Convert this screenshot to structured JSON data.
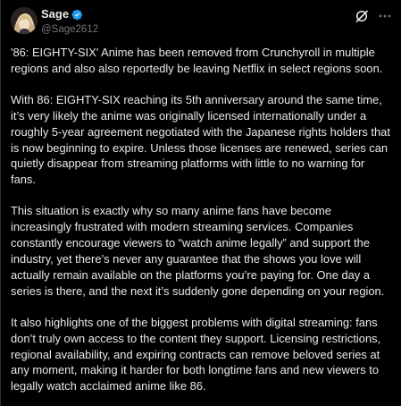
{
  "author": {
    "display_name": "Sage",
    "handle": "@Sage2612",
    "verified": true
  },
  "icons": {
    "avatar": "avatar-image",
    "verified": "verified-badge-icon",
    "grok": "grok-icon",
    "more": "more-options-icon"
  },
  "colors": {
    "background": "#000000",
    "text": "#e7e9ea",
    "muted": "#71767b",
    "verified": "#1d9bf0"
  },
  "post": {
    "paragraphs": [
      "'86: EIGHTY-SIX' Anime has been removed from Crunchyroll in multiple regions and also also reportedly be leaving Netflix in select regions soon.",
      "With 86: EIGHTY-SIX reaching its 5th anniversary around the same time, it’s very likely the anime was originally licensed internationally under a roughly 5-year agreement negotiated with the Japanese rights holders that is now beginning to expire. Unless those licenses are renewed, series can quietly disappear from streaming platforms with little to no warning for fans.",
      "This situation is exactly why so many anime fans have become increasingly frustrated with modern streaming services. Companies constantly encourage viewers to “watch anime legally” and support the industry, yet there’s never any guarantee that the shows you love will actually remain available on the platforms you’re paying for. One day a series is there, and the next it’s suddenly gone depending on your region.",
      "It also highlights one of the biggest problems with digital streaming: fans don’t truly own access to the content they support. Licensing restrictions, regional availability, and expiring contracts can remove beloved series at any moment, making it harder for both longtime fans and new viewers to legally watch acclaimed anime like 86."
    ]
  }
}
